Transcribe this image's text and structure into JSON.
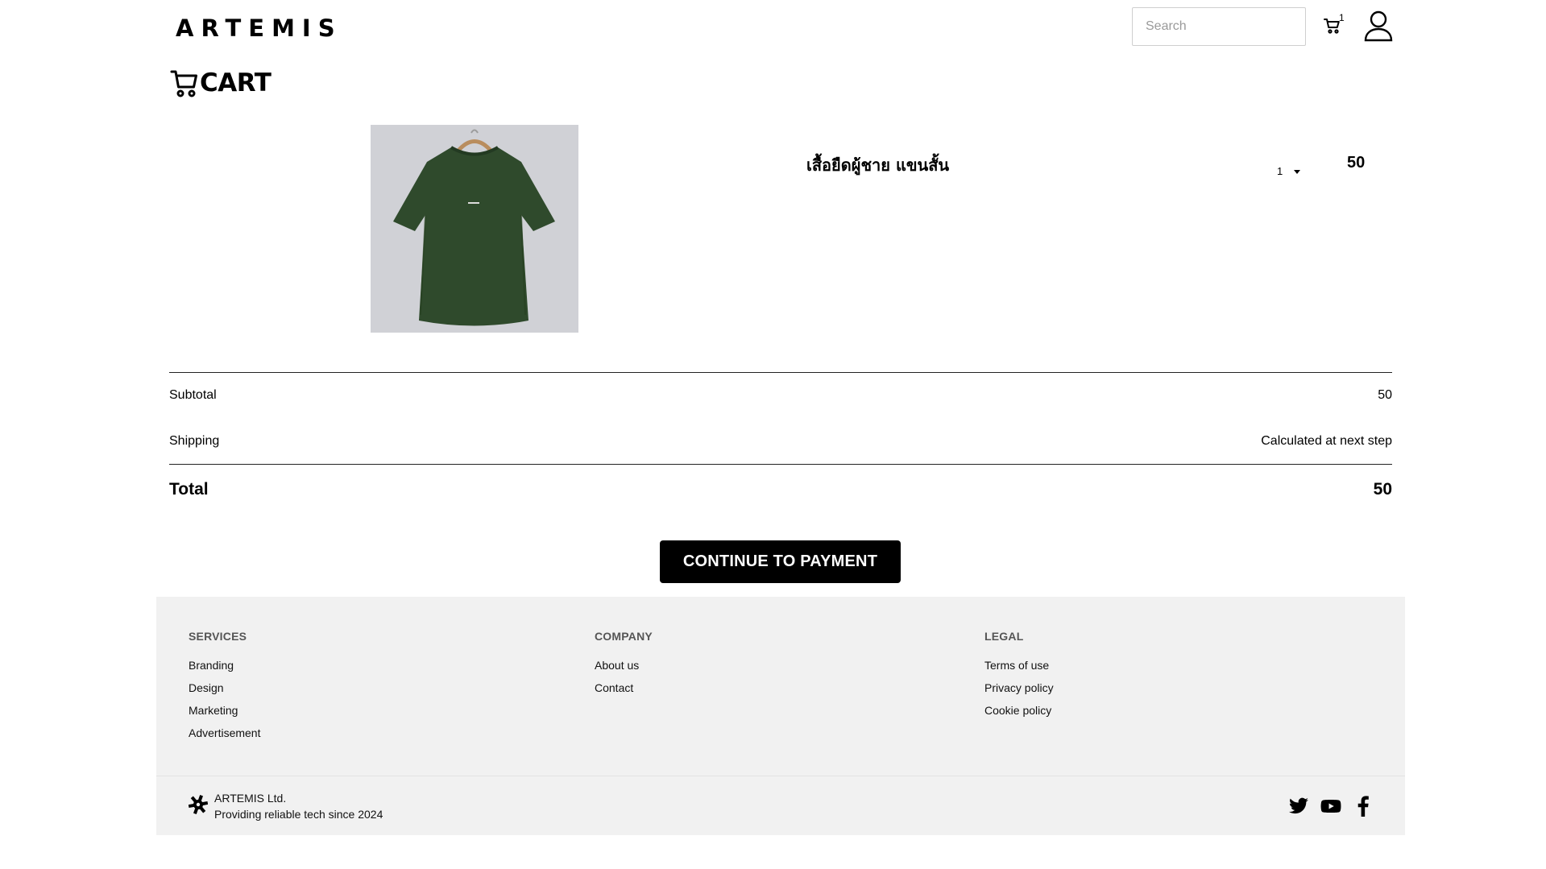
{
  "header": {
    "logo": "ARTEMIS",
    "search_placeholder": "Search",
    "cart_count": "1"
  },
  "cart": {
    "title": "CART",
    "items": [
      {
        "name": "เสื้อยืดผู้ชาย แขนสั้น",
        "quantity": "1",
        "price": "50"
      }
    ]
  },
  "summary": {
    "subtotal_label": "Subtotal",
    "subtotal_value": "50",
    "shipping_label": "Shipping",
    "shipping_value": "Calculated at next step",
    "total_label": "Total",
    "total_value": "50"
  },
  "checkout_button": "CONTINUE TO PAYMENT",
  "footer": {
    "services": {
      "heading": "SERVICES",
      "links": [
        "Branding",
        "Design",
        "Marketing",
        "Advertisement"
      ]
    },
    "company": {
      "heading": "COMPANY",
      "links": [
        "About us",
        "Contact"
      ]
    },
    "legal": {
      "heading": "LEGAL",
      "links": [
        "Terms of use",
        "Privacy policy",
        "Cookie policy"
      ]
    },
    "brand_name": "ARTEMIS Ltd.",
    "brand_tagline": "Providing reliable tech since 2024",
    "social_icons": [
      "twitter-icon",
      "youtube-icon",
      "facebook-icon"
    ]
  },
  "colors": {
    "accent": "#000000",
    "footer_bg": "#f1f1f1",
    "product_bg": "#d0d1d6",
    "shirt": "#2f4a2c"
  }
}
